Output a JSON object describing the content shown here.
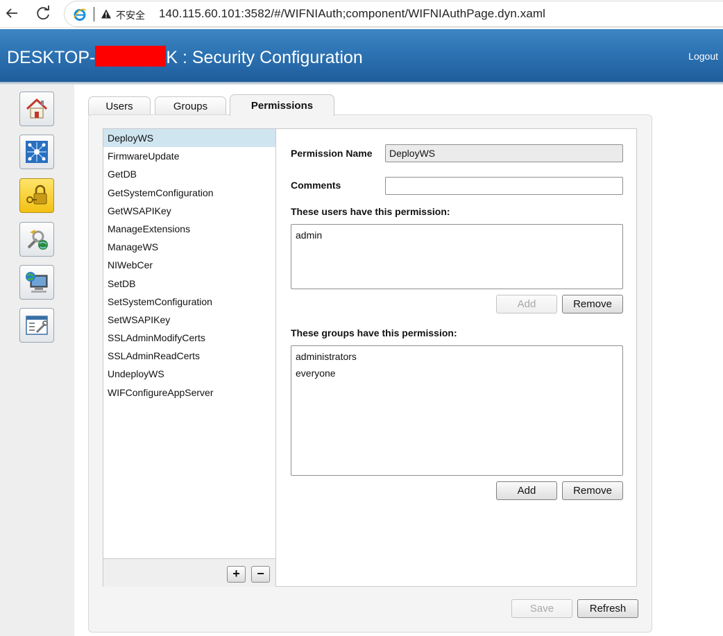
{
  "browser": {
    "security_warning": "不安全",
    "url": "140.115.60.101:3582/#/WIFNIAuth;component/WIFNIAuthPage.dyn.xaml"
  },
  "header": {
    "title_prefix": "DESKTOP-",
    "title_suffix": "K : Security Configuration",
    "logout": "Logout",
    "colors": {
      "header_top": "#3e86c4",
      "header_bottom": "#1f5d9c",
      "selected_row": "#cfe5f0"
    }
  },
  "rail": {
    "items": [
      {
        "icon": "home-icon"
      },
      {
        "icon": "network-icon"
      },
      {
        "icon": "security-lock-icon",
        "active": true
      },
      {
        "icon": "software-tools-icon"
      },
      {
        "icon": "remote-computer-icon"
      },
      {
        "icon": "system-settings-icon"
      }
    ]
  },
  "tabs": [
    {
      "label": "Users"
    },
    {
      "label": "Groups"
    },
    {
      "label": "Permissions",
      "active": true
    }
  ],
  "permissions": {
    "items": [
      "DeployWS",
      "FirmwareUpdate",
      "GetDB",
      "GetSystemConfiguration",
      "GetWSAPIKey",
      "ManageExtensions",
      "ManageWS",
      "NIWebCer",
      "SetDB",
      "SetSystemConfiguration",
      "SetWSAPIKey",
      "SSLAdminModifyCerts",
      "SSLAdminReadCerts",
      "UndeployWS",
      "WIFConfigureAppServer"
    ],
    "selected": "DeployWS",
    "add_label": "+",
    "remove_label": "−"
  },
  "details": {
    "name_label": "Permission Name",
    "name_value": "DeployWS",
    "comments_label": "Comments",
    "comments_value": "",
    "users_label": "These users have this permission:",
    "users": [
      "admin"
    ],
    "groups_label": "These groups have this permission:",
    "groups": [
      "administrators",
      "everyone"
    ],
    "add_label": "Add",
    "remove_label": "Remove"
  },
  "footer": {
    "save_label": "Save",
    "refresh_label": "Refresh"
  }
}
